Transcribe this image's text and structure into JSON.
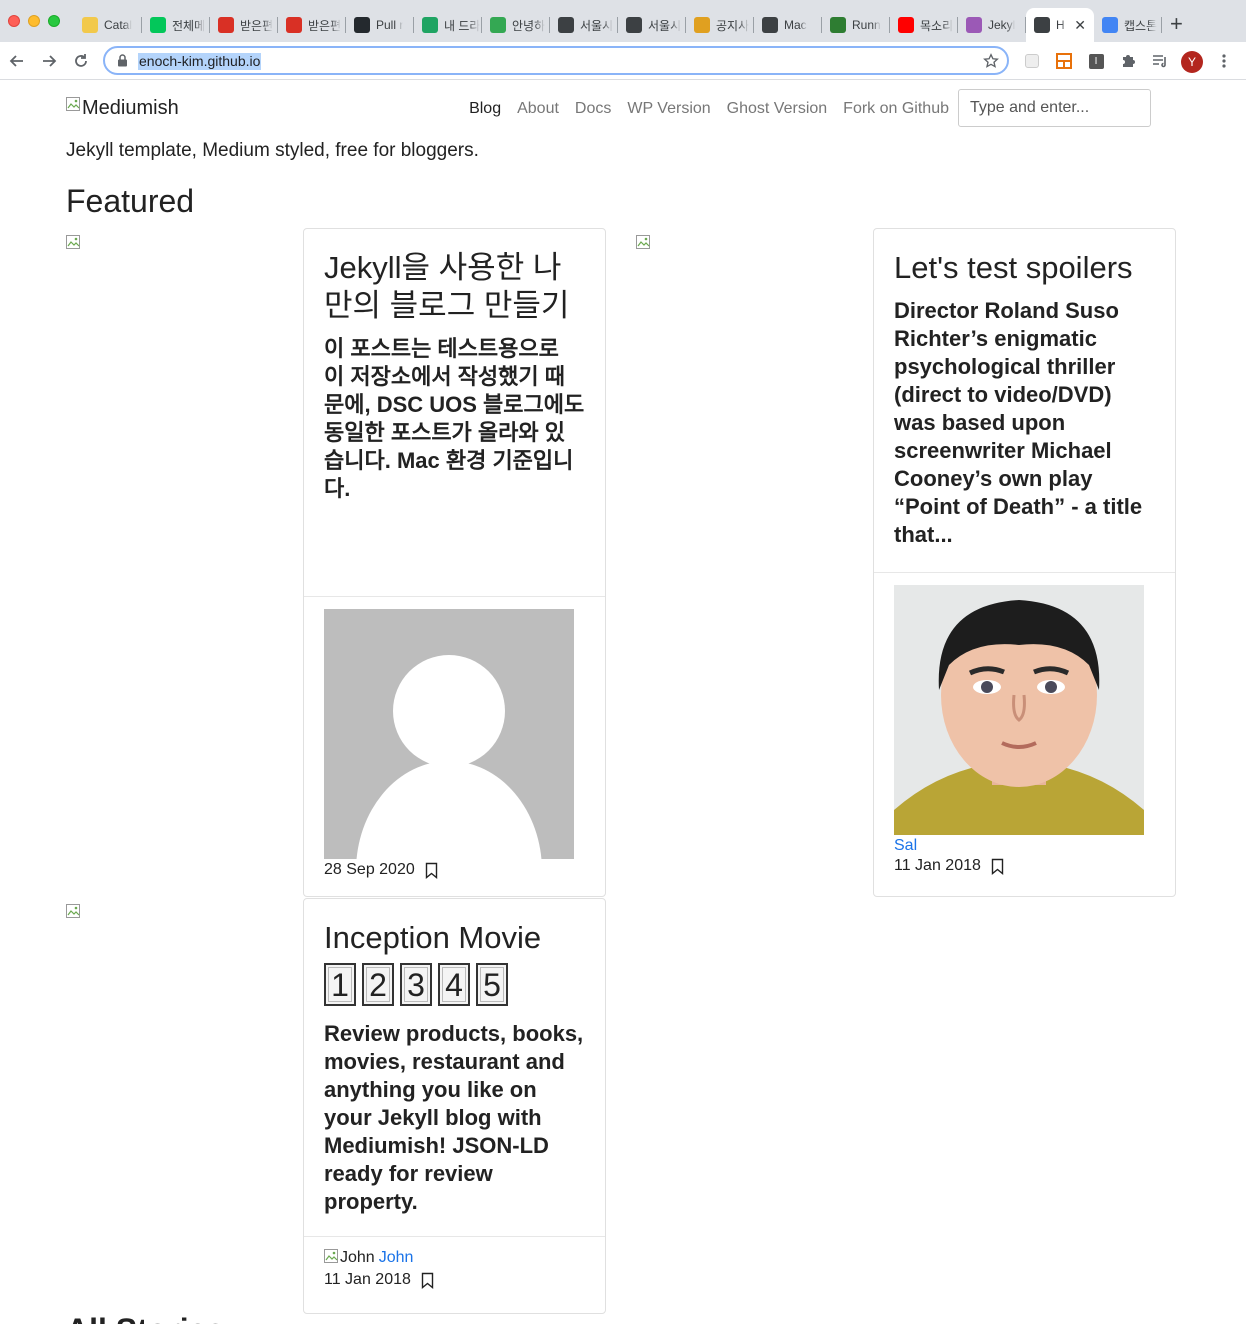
{
  "browser": {
    "tabs": [
      {
        "title": "Catal",
        "icon": "catalog-icon",
        "color": "#f2c94c"
      },
      {
        "title": "전체메",
        "icon": "mail-check-icon",
        "color": "#03c75a"
      },
      {
        "title": "받은편",
        "icon": "gmail-icon",
        "color": "#d93025"
      },
      {
        "title": "받은편",
        "icon": "gmail-icon",
        "color": "#d93025"
      },
      {
        "title": "Pull r",
        "icon": "github-icon",
        "color": "#24292e"
      },
      {
        "title": "내 드라",
        "icon": "google-drive-icon",
        "color": "#1fa463"
      },
      {
        "title": "안녕하",
        "icon": "sheet-icon",
        "color": "#34a853"
      },
      {
        "title": "서울시",
        "icon": "globe-icon",
        "color": "#3c4043"
      },
      {
        "title": "서울시",
        "icon": "globe-icon",
        "color": "#3c4043"
      },
      {
        "title": "공지사",
        "icon": "notice-icon",
        "color": "#e0a020"
      },
      {
        "title": "Mac",
        "icon": "dots-icon",
        "color": "#3c4043"
      },
      {
        "title": "Runn",
        "icon": "grid-icon",
        "color": "#2e7d32"
      },
      {
        "title": "목소리",
        "icon": "youtube-icon",
        "color": "#ff0000"
      },
      {
        "title": "Jekyl",
        "icon": "jekyll-icon",
        "color": "#9b59b6"
      },
      {
        "title": "H",
        "icon": "globe-icon",
        "color": "#3c4043",
        "active": true
      },
      {
        "title": "캡스톤",
        "icon": "docs-icon",
        "color": "#4285f4"
      }
    ],
    "url": "enoch-kim.github.io",
    "profile_initial": "Y"
  },
  "site": {
    "logo_alt": "Mediumish",
    "nav": [
      "Blog",
      "About",
      "Docs",
      "WP Version",
      "Ghost Version",
      "Fork on Github"
    ],
    "search_placeholder": "Type and enter...",
    "tagline": "Jekyll template, Medium styled, free for bloggers.",
    "featured_heading": "Featured",
    "all_stories_heading": "All Stories"
  },
  "posts": [
    {
      "title": "Jekyll을 사용한 나만의 블로그 만들기",
      "excerpt": "이 포스트는 테스트용으로 이 저장소에서 작성했기 때문에, DSC UOS 블로그에도 동일한 포스트가 올라와 있습니다. Mac 환경 기준입니다.",
      "date": "28 Sep 2020"
    },
    {
      "title": "Let's test spoilers",
      "excerpt": "Director Roland Suso Richter’s enigmatic psychological thriller (direct to video/DVD) was based upon screenwriter Michael Cooney’s own play “Point of Death” - a title that...",
      "author": "Sal",
      "date": "11 Jan 2018"
    },
    {
      "title": "Inception Movie",
      "rating": [
        "1",
        "2",
        "3",
        "4",
        "5"
      ],
      "excerpt": "Review products, books, movies, restaurant and anything you like on your Jekyll blog with Mediumish! JSON-LD ready for review property.",
      "author_alt": "John",
      "author": "John",
      "date": "11 Jan 2018"
    }
  ]
}
